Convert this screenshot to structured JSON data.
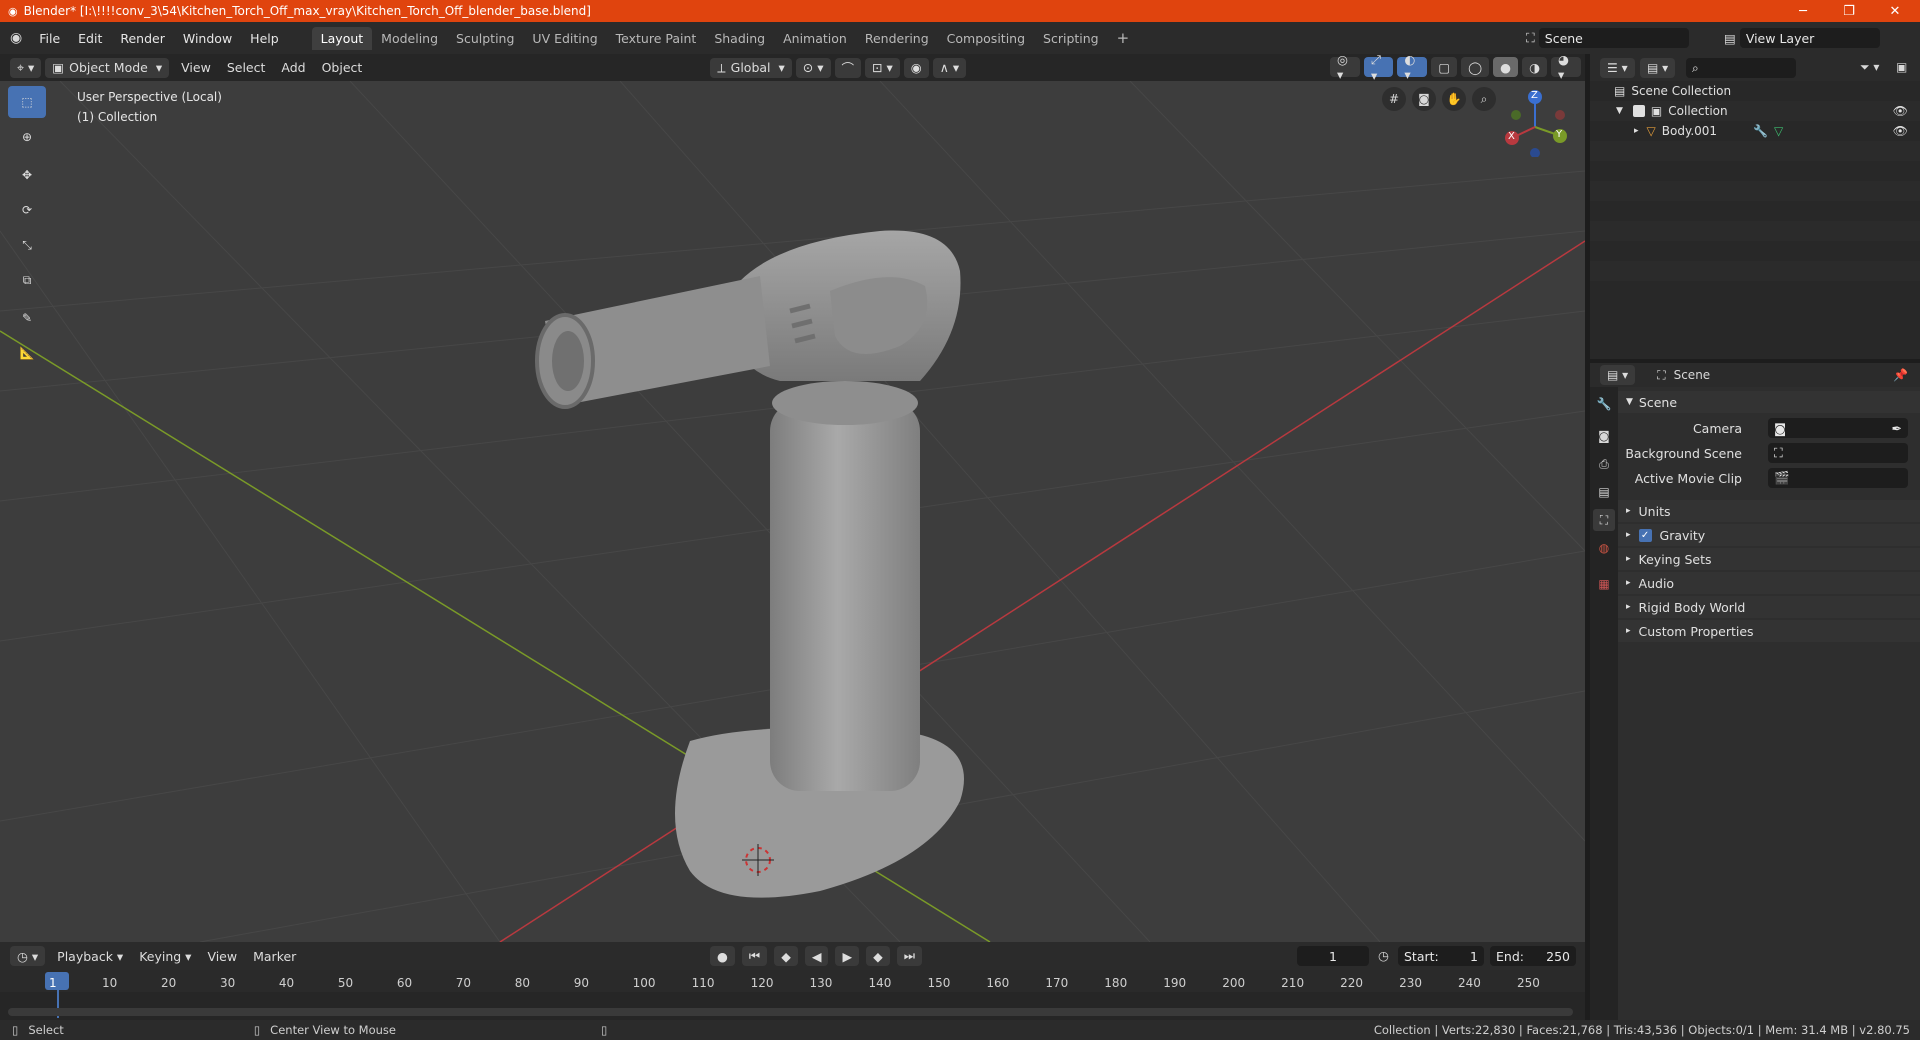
{
  "titlebar": {
    "title": "Blender* [I:\\!!!!conv_3\\54\\Kitchen_Torch_Off_max_vray\\Kitchen_Torch_Off_blender_base.blend]",
    "minimize": "─",
    "maximize": "❐",
    "close": "✕"
  },
  "menus": [
    "File",
    "Edit",
    "Render",
    "Window",
    "Help"
  ],
  "workspaces": [
    "Layout",
    "Modeling",
    "Sculpting",
    "UV Editing",
    "Texture Paint",
    "Shading",
    "Animation",
    "Rendering",
    "Compositing",
    "Scripting"
  ],
  "add_workspace": "+",
  "scene_field": "Scene",
  "view_layer_field": "View Layer",
  "viewport_header": {
    "mode": "Object Mode",
    "menus": [
      "View",
      "Select",
      "Add",
      "Object"
    ],
    "orientation": "Global"
  },
  "viewport": {
    "perspective": "User Perspective (Local)",
    "collection": "(1) Collection",
    "gizmo": {
      "z": "Z",
      "y": "Y",
      "x": "X"
    }
  },
  "outliner": {
    "scene_collection": "Scene Collection",
    "collection": "Collection",
    "object": "Body.001"
  },
  "properties": {
    "header": "Scene",
    "panel": "Scene",
    "camera_label": "Camera",
    "background_scene_label": "Background Scene",
    "active_movie_clip_label": "Active Movie Clip",
    "sections": [
      "Units",
      "Gravity",
      "Keying Sets",
      "Audio",
      "Rigid Body World",
      "Custom Properties"
    ],
    "gravity_checked": true
  },
  "timeline": {
    "menus": [
      "Playback",
      "Keying",
      "View",
      "Marker"
    ],
    "current_frame": "1",
    "start_label": "Start:",
    "start": "1",
    "end_label": "End:",
    "end": "250",
    "ticks": [
      "1",
      "10",
      "20",
      "30",
      "40",
      "50",
      "60",
      "70",
      "80",
      "90",
      "100",
      "110",
      "120",
      "130",
      "140",
      "150",
      "160",
      "170",
      "180",
      "190",
      "200",
      "210",
      "220",
      "230",
      "240",
      "250"
    ]
  },
  "statusbar": {
    "select": "Select",
    "center_view": "Center View to Mouse",
    "stats": "Collection | Verts:22,830 | Faces:21,768 | Tris:43,536 | Objects:0/1 | Mem: 31.4 MB | v2.80.75"
  },
  "colors": {
    "titlebar": "#e0440e",
    "accent": "#4772b3",
    "x_axis": "#b8393f",
    "y_axis": "#7a9a28",
    "z_axis": "#3a6fd0"
  }
}
